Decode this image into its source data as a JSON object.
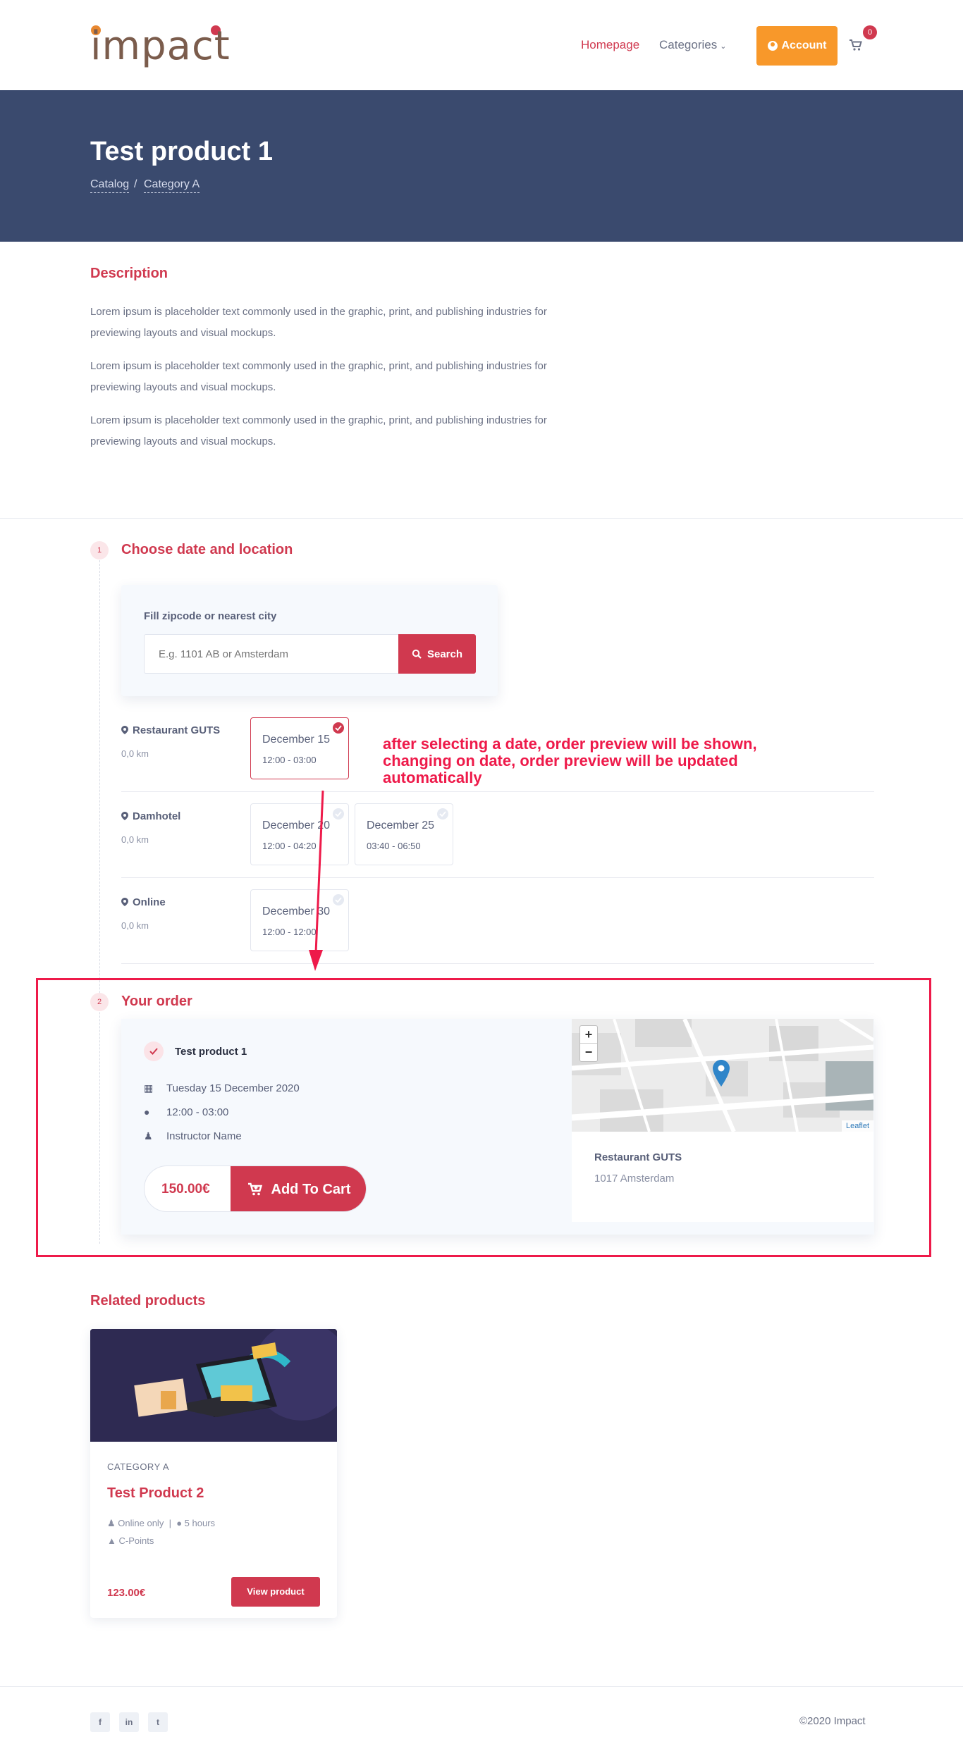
{
  "header": {
    "logo": "impact",
    "nav_home": "Homepage",
    "nav_categories": "Categories",
    "account": "Account",
    "cart_count": "0"
  },
  "hero": {
    "title": "Test product 1",
    "breadcrumbs": [
      "Catalog",
      "Category A"
    ],
    "separator": "/"
  },
  "description": {
    "heading": "Description",
    "paragraphs": [
      "Lorem ipsum is placeholder text commonly used in the graphic, print, and publishing industries for previewing layouts and visual mockups.",
      "Lorem ipsum is placeholder text commonly used in the graphic, print, and publishing industries for previewing layouts and visual mockups.",
      "Lorem ipsum is placeholder text commonly used in the graphic, print, and publishing industries for previewing layouts and visual mockups."
    ]
  },
  "step1": {
    "num": "1",
    "heading": "Choose date and location",
    "search_label": "Fill zipcode or nearest city",
    "search_placeholder": "E.g. 1101 AB or Amsterdam",
    "search_button": "Search",
    "locations": [
      {
        "name": "Restaurant GUTS",
        "distance": "0,0 km",
        "dates": [
          {
            "date": "December 15",
            "time": "12:00 - 03:00",
            "selected": true
          }
        ]
      },
      {
        "name": "Damhotel",
        "distance": "0,0 km",
        "dates": [
          {
            "date": "December 20",
            "time": "12:00 - 04:20",
            "selected": false
          },
          {
            "date": "December 25",
            "time": "03:40 - 06:50",
            "selected": false
          }
        ]
      },
      {
        "name": "Online",
        "distance": "0,0 km",
        "dates": [
          {
            "date": "December 30",
            "time": "12:00 - 12:00",
            "selected": false
          }
        ]
      }
    ]
  },
  "annotation": "after selecting a date, order preview will be shown, changing on date, order preview will be updated automatically",
  "step2": {
    "num": "2",
    "heading": "Your order",
    "product": "Test product 1",
    "date": "Tuesday 15 December 2020",
    "time": "12:00 - 03:00",
    "instructor": "Instructor Name",
    "price": "150.00€",
    "add_to_cart": "Add To Cart",
    "map_attribution": "Leaflet",
    "map_zoom_in": "+",
    "map_zoom_out": "−",
    "venue_name": "Restaurant GUTS",
    "venue_address": "1017 Amsterdam"
  },
  "related": {
    "heading": "Related products",
    "products": [
      {
        "category": "CATEGORY A",
        "title": "Test Product 2",
        "delivery": "Online only",
        "duration": "5 hours",
        "points": "C-Points",
        "price": "123.00€",
        "button": "View product"
      }
    ]
  },
  "footer": {
    "social": [
      "f",
      "in",
      "t"
    ],
    "copyright": "©2020 Impact"
  },
  "colors": {
    "brand_red": "#d0394f",
    "hero_bg": "#3a4a6e",
    "account_orange": "#f8982a",
    "annotation": "#ee1a4a"
  }
}
